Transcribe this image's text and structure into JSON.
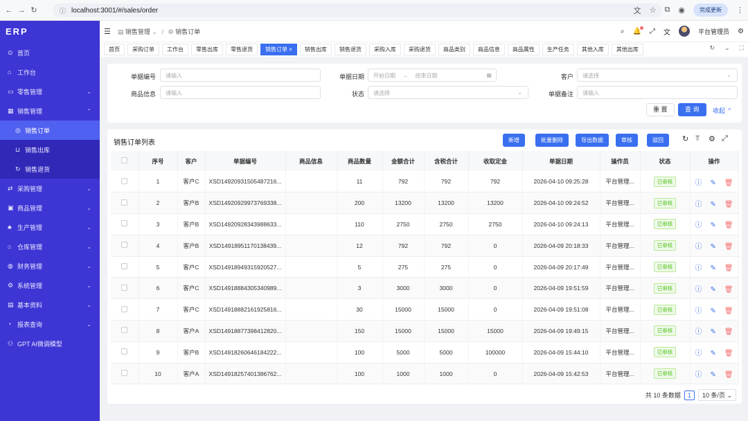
{
  "browser": {
    "url": "localhost:3001/#/sales/order",
    "update_label": "完成更新"
  },
  "sidebar": {
    "logo": "ERP",
    "items": [
      {
        "label": "首页",
        "icon": "home-icon",
        "arrow": ""
      },
      {
        "label": "工作台",
        "icon": "house-icon",
        "arrow": ""
      },
      {
        "label": "零售管理",
        "icon": "folder-icon",
        "arrow": "⌄"
      },
      {
        "label": "销售管理",
        "icon": "grid-icon",
        "arrow": "⌃"
      },
      {
        "label": "销售订单",
        "icon": "circle-icon",
        "arrow": "",
        "sub": true,
        "active": true
      },
      {
        "label": "销售出库",
        "icon": "cart-icon",
        "arrow": "",
        "sub": true
      },
      {
        "label": "销售退货",
        "icon": "refresh-icon",
        "arrow": "",
        "sub": true
      },
      {
        "label": "采购管理",
        "icon": "swap-icon",
        "arrow": "⌄"
      },
      {
        "label": "商品管理",
        "icon": "box-icon",
        "arrow": "⌄"
      },
      {
        "label": "生产管理",
        "icon": "bell-icon",
        "arrow": "⌄"
      },
      {
        "label": "仓库管理",
        "icon": "bank-icon",
        "arrow": "⌄"
      },
      {
        "label": "财务管理",
        "icon": "money-icon",
        "arrow": "⌄"
      },
      {
        "label": "系统管理",
        "icon": "gear-icon",
        "arrow": "⌄"
      },
      {
        "label": "基本资料",
        "icon": "table-icon",
        "arrow": "⌄"
      },
      {
        "label": "报表查询",
        "icon": "chart-icon",
        "arrow": "⌄"
      },
      {
        "label": "GPT AI微调模型",
        "icon": "ai-icon",
        "arrow": ""
      }
    ]
  },
  "header": {
    "crumb1": "销售管理",
    "crumb2": "销售订单",
    "user": "平台管理员"
  },
  "tabs": [
    "首页",
    "采购订单",
    "工作台",
    "零售出库",
    "零售退货",
    "销售订单",
    "销售出库",
    "销售退货",
    "采购入库",
    "采购退货",
    "商品类别",
    "商品信息",
    "商品属性",
    "生产任务",
    "其他入库",
    "其他出库"
  ],
  "filter": {
    "order_no_label": "单据编号",
    "order_no_ph": "请输入",
    "date_label": "单据日期",
    "date_start_ph": "开始日期",
    "date_end_ph": "结束日期",
    "customer_label": "客户",
    "customer_ph": "请选择",
    "goods_label": "商品信息",
    "goods_ph": "请输入",
    "status_label": "状态",
    "status_ph": "请选择",
    "remark_label": "单据备注",
    "remark_ph": "请输入",
    "reset": "重 置",
    "search": "查 询",
    "collapse": "收起"
  },
  "table": {
    "title": "销售订单列表",
    "buttons": [
      "新增",
      "批量删除",
      "导出数据",
      "审核",
      "驳回"
    ],
    "columns": [
      "序号",
      "客户",
      "单据编号",
      "商品信息",
      "商品数量",
      "金额合计",
      "含税合计",
      "收取定金",
      "单据日期",
      "操作员",
      "状态",
      "操作"
    ],
    "rows": [
      {
        "idx": "1",
        "customer": "客户C",
        "no": "XSD14920931505487216...",
        "goods": "",
        "qty": "11",
        "amount": "792",
        "tax": "792",
        "deposit": "792",
        "date": "2026-04-10 09:25:28",
        "operator": "平台管理...",
        "status": "已审核"
      },
      {
        "idx": "2",
        "customer": "客户B",
        "no": "XSD14920929973769338...",
        "goods": "",
        "qty": "200",
        "amount": "13200",
        "tax": "13200",
        "deposit": "13200",
        "date": "2026-04-10 09:24:52",
        "operator": "平台管理...",
        "status": "已审核"
      },
      {
        "idx": "3",
        "customer": "客户B",
        "no": "XSD14920928343988633...",
        "goods": "",
        "qty": "110",
        "amount": "2750",
        "tax": "2750",
        "deposit": "2750",
        "date": "2026-04-10 09:24:13",
        "operator": "平台管理...",
        "status": "已审核"
      },
      {
        "idx": "4",
        "customer": "客户B",
        "no": "XSD14918951170138439...",
        "goods": "",
        "qty": "12",
        "amount": "792",
        "tax": "792",
        "deposit": "0",
        "date": "2026-04-09 20:18:33",
        "operator": "平台管理...",
        "status": "已审核"
      },
      {
        "idx": "5",
        "customer": "客户C",
        "no": "XSD14918949315920527...",
        "goods": "",
        "qty": "5",
        "amount": "275",
        "tax": "275",
        "deposit": "0",
        "date": "2026-04-09 20:17:49",
        "operator": "平台管理...",
        "status": "已审核"
      },
      {
        "idx": "6",
        "customer": "客户C",
        "no": "XSD14918884305340989...",
        "goods": "",
        "qty": "3",
        "amount": "3000",
        "tax": "3000",
        "deposit": "0",
        "date": "2026-04-09 19:51:59",
        "operator": "平台管理...",
        "status": "已审核"
      },
      {
        "idx": "7",
        "customer": "客户C",
        "no": "XSD14918882161925816...",
        "goods": "",
        "qty": "30",
        "amount": "15000",
        "tax": "15000",
        "deposit": "0",
        "date": "2026-04-09 19:51:08",
        "operator": "平台管理...",
        "status": "已审核"
      },
      {
        "idx": "8",
        "customer": "客户A",
        "no": "XSD14918877398412820...",
        "goods": "",
        "qty": "150",
        "amount": "15000",
        "tax": "15000",
        "deposit": "15000",
        "date": "2026-04-09 19:49:15",
        "operator": "平台管理...",
        "status": "已审核"
      },
      {
        "idx": "9",
        "customer": "客户B",
        "no": "XSD14918260646184222...",
        "goods": "",
        "qty": "100",
        "amount": "5000",
        "tax": "5000",
        "deposit": "100000",
        "date": "2026-04-09 15:44:10",
        "operator": "平台管理...",
        "status": "已审核"
      },
      {
        "idx": "10",
        "customer": "客户A",
        "no": "XSD14918257401386762...",
        "goods": "",
        "qty": "100",
        "amount": "1000",
        "tax": "1000",
        "deposit": "0",
        "date": "2026-04-09 15:42:53",
        "operator": "平台管理...",
        "status": "已审核"
      }
    ]
  },
  "pager": {
    "total": "共 10 条数据",
    "page": "1",
    "size": "10 条/页"
  },
  "colors": {
    "sidebar": "#3d35d4",
    "primary": "#3a6ff0",
    "active_menu": "#5060f0",
    "danger": "#f56c6c",
    "success": "#52c41a"
  }
}
